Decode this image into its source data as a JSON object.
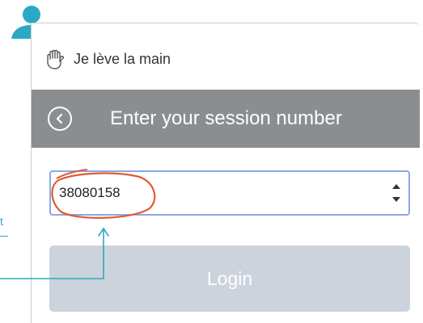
{
  "app": {
    "title": "Je lève la main"
  },
  "header": {
    "title": "Enter your session number"
  },
  "session_input": {
    "value": "38080158"
  },
  "login": {
    "label": "Login"
  },
  "annotation": {
    "side_note": "t"
  },
  "colors": {
    "user_icon": "#2ba9c4",
    "header_bg": "#8b8e91",
    "login_bg": "#ccd3dc",
    "highlight_circle": "#e05a35",
    "annotation_line": "#2ba9c4"
  },
  "icons": [
    "user-icon",
    "raised-hand-icon",
    "back-chevron-icon",
    "spinner-up-icon",
    "spinner-down-icon",
    "annotation-arrow-icon"
  ]
}
